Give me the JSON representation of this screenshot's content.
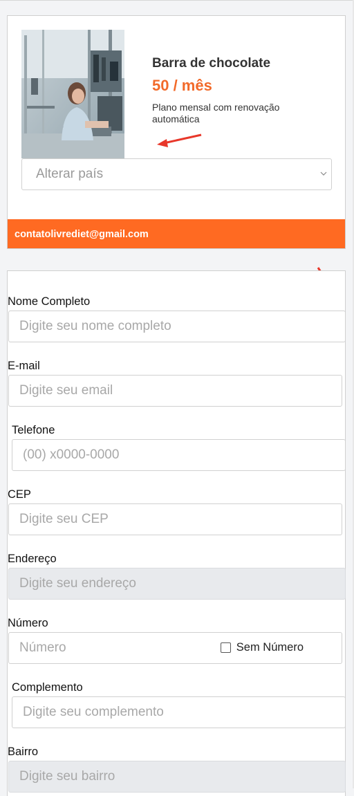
{
  "product": {
    "title": "Barra de chocolate",
    "price": "50 / mês",
    "description": "Plano mensal com renovação automática",
    "country_select_placeholder": "Alterar país",
    "contact_email": "contatolivrediet@gmail.com"
  },
  "form": {
    "fields": {
      "name": {
        "label": "Nome Completo",
        "placeholder": "Digite seu nome completo"
      },
      "email": {
        "label": "E-mail",
        "placeholder": "Digite seu email"
      },
      "phone": {
        "label": "Telefone",
        "placeholder": "(00) x0000-0000"
      },
      "cep": {
        "label": "CEP",
        "placeholder": "Digite seu CEP"
      },
      "address": {
        "label": "Endereço",
        "placeholder": "Digite seu endereço"
      },
      "number": {
        "label": "Número",
        "placeholder": "Número",
        "no_number_label": "Sem Número"
      },
      "complement": {
        "label": "Complemento",
        "placeholder": "Digite seu complemento"
      },
      "neighborhood": {
        "label": "Bairro",
        "placeholder": "Digite seu bairro"
      }
    }
  },
  "colors": {
    "accent": "#ff6a22",
    "price": "#f26a2a",
    "annotation_arrow": "#e8372a"
  }
}
